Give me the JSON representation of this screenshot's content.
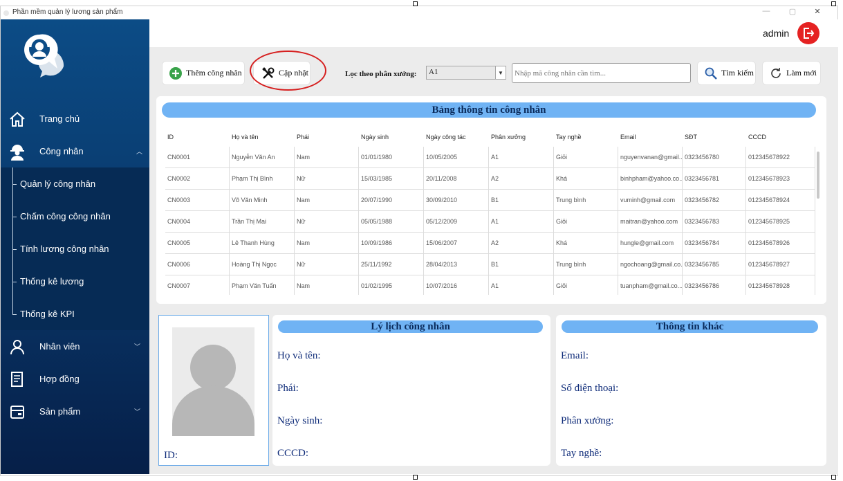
{
  "window": {
    "title": "Phần mềm quản lý lương sản phẩm",
    "controls": [
      "—",
      "▢",
      "✕"
    ]
  },
  "sidebar": {
    "logo_icon": "worker-support-logo",
    "items": [
      {
        "label": "Trang chủ",
        "icon": "home-icon"
      },
      {
        "label": "Công nhân",
        "icon": "worker-helmet-icon",
        "expanded": true
      },
      {
        "label": "Nhân viên",
        "icon": "person-icon"
      },
      {
        "label": "Hợp đồng",
        "icon": "contract-icon"
      },
      {
        "label": "Sản phẩm",
        "icon": "product-box-icon"
      }
    ],
    "subitems": [
      {
        "label": "Quản lý công nhân"
      },
      {
        "label": "Chấm công công nhân"
      },
      {
        "label": "Tính lương công nhân"
      },
      {
        "label": "Thống kê lương"
      },
      {
        "label": "Thống kê KPI"
      }
    ]
  },
  "header": {
    "user": "admin"
  },
  "toolbar": {
    "add_label": "Thêm công nhân",
    "update_label": "Cập nhật",
    "filter_label": "Lọc theo phân xưởng:",
    "filter_value": "A1",
    "search_placeholder": "Nhập mã công nhân cần tìm...",
    "search_label": "Tìm kiếm",
    "refresh_label": "Làm mới"
  },
  "table": {
    "title": "Bảng thông tin công nhân",
    "columns": [
      "ID",
      "Họ và tên",
      "Phái",
      "Ngày sinh",
      "Ngày công tác",
      "Phân xưởng",
      "Tay nghề",
      "Email",
      "SĐT",
      "CCCD"
    ],
    "rows": [
      [
        "CN0001",
        "Nguyễn Văn An",
        "Nam",
        "01/01/1980",
        "10/05/2005",
        "A1",
        "Giỏi",
        "nguyenvanan@gmail...",
        "0323456780",
        "012345678922"
      ],
      [
        "CN0002",
        "Phạm Thị Bình",
        "Nữ",
        "15/03/1985",
        "20/11/2008",
        "A2",
        "Khá",
        "binhpham@yahoo.co...",
        "0323456781",
        "012345678923"
      ],
      [
        "CN0003",
        "Võ Văn Minh",
        "Nam",
        "20/07/1990",
        "30/09/2010",
        "B1",
        "Trung bình",
        "vuminh@gmail.com",
        "0323456782",
        "012345678924"
      ],
      [
        "CN0004",
        "Trần Thị Mai",
        "Nữ",
        "05/05/1988",
        "05/12/2009",
        "A1",
        "Giỏi",
        "maitran@yahoo.com",
        "0323456783",
        "012345678925"
      ],
      [
        "CN0005",
        "Lê Thanh Hùng",
        "Nam",
        "10/09/1986",
        "15/06/2007",
        "A2",
        "Khá",
        "hungle@gmail.com",
        "0323456784",
        "012345678926"
      ],
      [
        "CN0006",
        "Hoàng Thị Ngọc",
        "Nữ",
        "25/11/1992",
        "28/04/2013",
        "B1",
        "Trung bình",
        "ngochoang@gmail.co...",
        "0323456785",
        "012345678927"
      ],
      [
        "CN0007",
        "Phạm Văn Tuấn",
        "Nam",
        "01/02/1995",
        "10/07/2016",
        "A1",
        "Giỏi",
        "tuanpham@gmail.co...",
        "0323456786",
        "012345678928"
      ]
    ]
  },
  "profile": {
    "id_label": "ID:",
    "title": "Lý lịch công nhân",
    "fields": [
      "Họ và tên:",
      "Phái:",
      "Ngày sinh:",
      "CCCD:"
    ]
  },
  "other": {
    "title": "Thông tin khác",
    "fields": [
      "Email:",
      "Số điện thoại:",
      "Phân xưởng:",
      "Tay nghề:"
    ]
  },
  "colors": {
    "sidebar_top": "#0c4c86",
    "sidebar_bottom": "#061f48",
    "pill": "#70b3f4",
    "logout": "#e52222",
    "highlight": "#d61f1f",
    "field_text": "#0d2a78"
  }
}
